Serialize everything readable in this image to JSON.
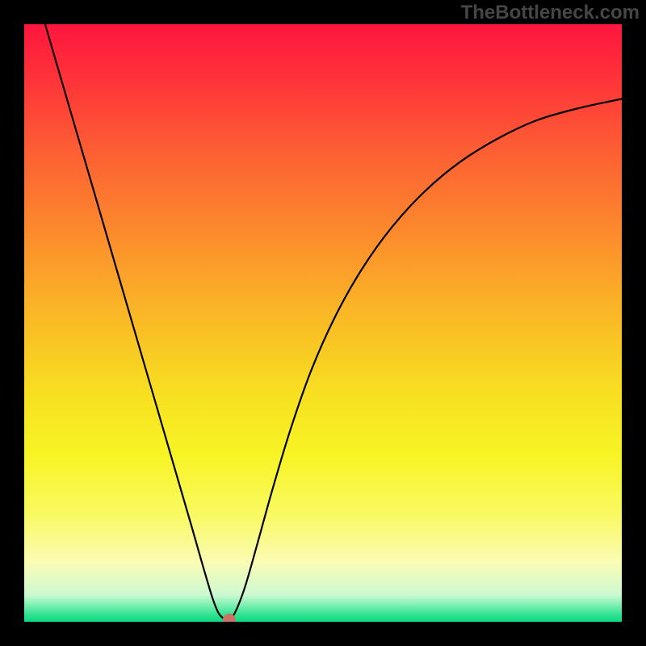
{
  "watermark": "TheBottleneck.com",
  "chart_data": {
    "type": "line",
    "title": "",
    "xlabel": "",
    "ylabel": "",
    "xlim": [
      0,
      1
    ],
    "ylim": [
      0,
      1
    ],
    "gradient_bands": [
      {
        "color": "#fe163d",
        "stop": 0.0
      },
      {
        "color": "#fe2f3a",
        "stop": 0.08
      },
      {
        "color": "#fd5a34",
        "stop": 0.2
      },
      {
        "color": "#fc882d",
        "stop": 0.34
      },
      {
        "color": "#fab626",
        "stop": 0.48
      },
      {
        "color": "#f7e021",
        "stop": 0.62
      },
      {
        "color": "#f7f424",
        "stop": 0.72
      },
      {
        "color": "#f9f961",
        "stop": 0.82
      },
      {
        "color": "#fbfcb4",
        "stop": 0.9
      },
      {
        "color": "#ccf9d1",
        "stop": 0.955
      },
      {
        "color": "#6fedab",
        "stop": 0.975
      },
      {
        "color": "#28e18f",
        "stop": 0.99
      },
      {
        "color": "#0cda82",
        "stop": 1.0
      }
    ],
    "series": [
      {
        "name": "curve",
        "points": [
          {
            "x": 0.035,
            "y": 1.0
          },
          {
            "x": 0.07,
            "y": 0.88
          },
          {
            "x": 0.105,
            "y": 0.76
          },
          {
            "x": 0.14,
            "y": 0.64
          },
          {
            "x": 0.175,
            "y": 0.52
          },
          {
            "x": 0.21,
            "y": 0.4
          },
          {
            "x": 0.245,
            "y": 0.28
          },
          {
            "x": 0.28,
            "y": 0.16
          },
          {
            "x": 0.3,
            "y": 0.09
          },
          {
            "x": 0.315,
            "y": 0.04
          },
          {
            "x": 0.325,
            "y": 0.015
          },
          {
            "x": 0.335,
            "y": 0.005
          },
          {
            "x": 0.345,
            "y": 0.005
          },
          {
            "x": 0.355,
            "y": 0.02
          },
          {
            "x": 0.37,
            "y": 0.06
          },
          {
            "x": 0.39,
            "y": 0.13
          },
          {
            "x": 0.415,
            "y": 0.22
          },
          {
            "x": 0.445,
            "y": 0.32
          },
          {
            "x": 0.48,
            "y": 0.42
          },
          {
            "x": 0.52,
            "y": 0.51
          },
          {
            "x": 0.565,
            "y": 0.59
          },
          {
            "x": 0.615,
            "y": 0.66
          },
          {
            "x": 0.67,
            "y": 0.72
          },
          {
            "x": 0.73,
            "y": 0.77
          },
          {
            "x": 0.795,
            "y": 0.81
          },
          {
            "x": 0.86,
            "y": 0.84
          },
          {
            "x": 0.93,
            "y": 0.86
          },
          {
            "x": 1.0,
            "y": 0.875
          }
        ]
      }
    ],
    "marker": {
      "x": 0.343,
      "y": 0.003,
      "color": "#c97565",
      "radius_px": 8
    }
  }
}
